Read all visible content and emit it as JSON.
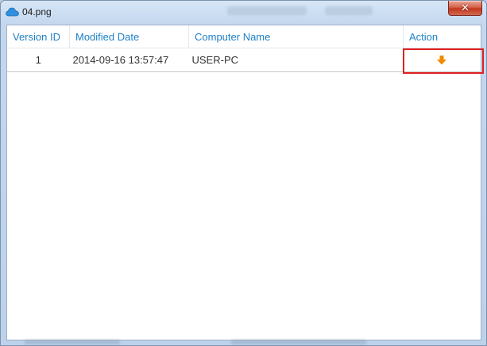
{
  "window": {
    "title": "04.png",
    "close_label": "✕"
  },
  "table": {
    "headers": [
      "Version ID",
      "Modified Date",
      "Computer Name",
      "Action"
    ],
    "rows": [
      {
        "version_id": "1",
        "modified_date": "2014-09-16 13:57:47",
        "computer_name": "USER-PC",
        "action_icon": "download-arrow-icon"
      }
    ]
  },
  "colors": {
    "header_text": "#1e7fc6",
    "action_icon": "#f08a00",
    "highlight": "#e02020",
    "close_button": "#c2391f"
  }
}
